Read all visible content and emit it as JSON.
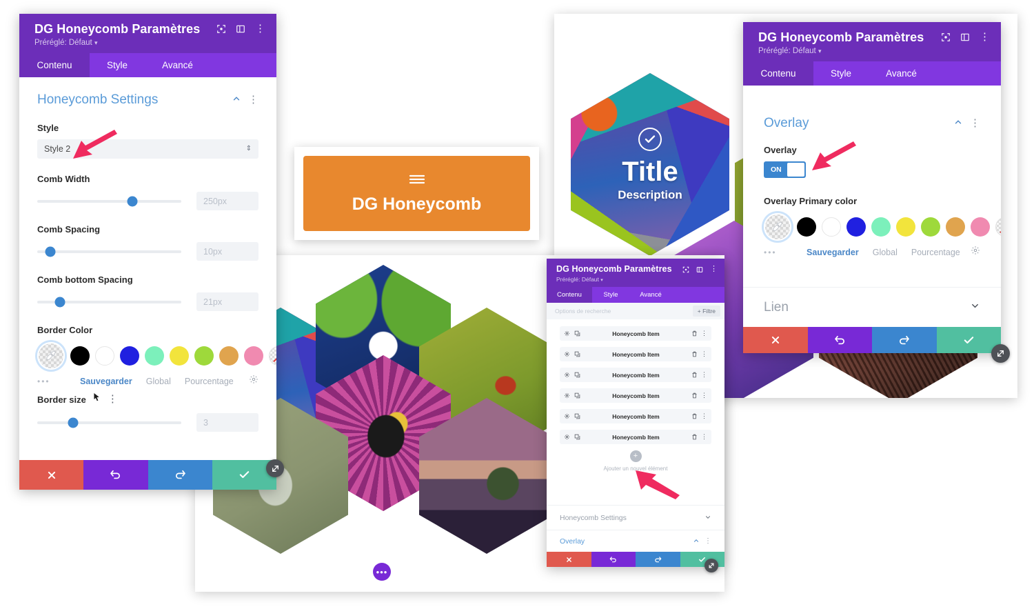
{
  "colors": {
    "header_purple": "#6c2eb9",
    "tabbar_purple": "#8137e0",
    "accent_blue": "#5a9bd8",
    "slider_blue": "#3b86cf",
    "orange_button": "#e8882e",
    "cancel_red": "#e0594e",
    "undo_purple": "#7829d6",
    "redo_blue": "#3b86cf",
    "save_green": "#51bfa0",
    "arrow_pink": "#ef2b5f"
  },
  "palette": {
    "swatches": [
      "#000000",
      "#ffffff",
      "#2020e0",
      "#7cf0bb",
      "#f2e43c",
      "#9ed93b",
      "#e0a44e",
      "#f08ab0"
    ],
    "picker_icon": "eyedropper-icon",
    "none_label": "no-color",
    "links": [
      {
        "label": "Sauvegarder",
        "active": true
      },
      {
        "label": "Global",
        "active": false
      },
      {
        "label": "Pourcentage",
        "active": false
      }
    ],
    "gear_icon": "gear-icon",
    "more_dots": "•••"
  },
  "left_panel": {
    "header": {
      "title": "DG Honeycomb Paramètres",
      "preset": "Préréglé: Défaut",
      "icons": [
        "fullscreen-icon",
        "layout-icon",
        "kebab-menu-icon"
      ]
    },
    "tabs": [
      {
        "label": "Contenu",
        "active": true
      },
      {
        "label": "Style",
        "active": false
      },
      {
        "label": "Avancé",
        "active": false
      }
    ],
    "section": {
      "title": "Honeycomb Settings",
      "collapse_icon": "chevron-up-icon",
      "kebab_icon": "kebab-menu-icon"
    },
    "fields": {
      "style_label": "Style",
      "style_value": "Style 2",
      "comb_width_label": "Comb Width",
      "comb_width_value": "250px",
      "comb_width_pct": 66,
      "comb_spacing_label": "Comb Spacing",
      "comb_spacing_value": "10px",
      "comb_spacing_pct": 9,
      "comb_bottom_label": "Comb bottom Spacing",
      "comb_bottom_value": "21px",
      "comb_bottom_pct": 16,
      "border_color_label": "Border Color",
      "border_size_label": "Border size",
      "border_size_value": "3",
      "border_size_pct": 25
    },
    "actions": [
      {
        "name": "cancel",
        "icon": "close-icon"
      },
      {
        "name": "undo",
        "icon": "undo-icon"
      },
      {
        "name": "redo",
        "icon": "redo-icon"
      },
      {
        "name": "save",
        "icon": "check-icon"
      }
    ]
  },
  "center_module": {
    "icon": "hamburger-icon",
    "label": "DG Honeycomb"
  },
  "hero_hex": {
    "check_icon": "check-circle-icon",
    "title": "Title",
    "description": "Description"
  },
  "middle_panel": {
    "header": {
      "title": "DG Honeycomb Paramètres",
      "preset": "Préréglé: Défaut",
      "icons": [
        "fullscreen-icon",
        "layout-icon",
        "kebab-menu-icon"
      ]
    },
    "tabs": [
      {
        "label": "Contenu",
        "active": true
      },
      {
        "label": "Style",
        "active": false
      },
      {
        "label": "Avancé",
        "active": false
      }
    ],
    "search_placeholder": "Options de recherche",
    "filter_button": "Filtre",
    "filter_icon": "plus-icon",
    "items": [
      {
        "name": "Honeycomb Item"
      },
      {
        "name": "Honeycomb Item"
      },
      {
        "name": "Honeycomb Item"
      },
      {
        "name": "Honeycomb Item"
      },
      {
        "name": "Honeycomb Item"
      },
      {
        "name": "Honeycomb Item"
      }
    ],
    "item_icons": {
      "settings": "gear-icon",
      "duplicate": "duplicate-icon",
      "delete": "trash-icon",
      "more": "kebab-menu-icon"
    },
    "add_button_icon": "plus-icon",
    "add_label": "Ajouter un nouvel élément",
    "collapsed_sections": [
      {
        "title": "Honeycomb Settings",
        "icon": "chevron-down-icon",
        "blue": false
      },
      {
        "title": "Overlay",
        "icon": "chevron-up-icon",
        "blue": true
      }
    ],
    "actions": [
      {
        "name": "cancel",
        "icon": "close-icon"
      },
      {
        "name": "undo",
        "icon": "undo-icon"
      },
      {
        "name": "redo",
        "icon": "redo-icon"
      },
      {
        "name": "save",
        "icon": "check-icon"
      }
    ]
  },
  "right_panel": {
    "header": {
      "title": "DG Honeycomb Paramètres",
      "preset": "Préréglé: Défaut",
      "icons": [
        "fullscreen-icon",
        "layout-icon",
        "kebab-menu-icon"
      ]
    },
    "tabs": [
      {
        "label": "Contenu",
        "active": true
      },
      {
        "label": "Style",
        "active": false
      },
      {
        "label": "Avancé",
        "active": false
      }
    ],
    "section": {
      "title": "Overlay",
      "collapse_icon": "chevron-up-icon",
      "kebab_icon": "kebab-menu-icon"
    },
    "overlay_label": "Overlay",
    "toggle_state": "ON",
    "overlay_color_label": "Overlay Primary color",
    "link_section": "Lien",
    "link_icon": "chevron-down-icon",
    "actions": [
      {
        "name": "cancel",
        "icon": "close-icon"
      },
      {
        "name": "undo",
        "icon": "undo-icon"
      },
      {
        "name": "redo",
        "icon": "redo-icon"
      },
      {
        "name": "save",
        "icon": "check-icon"
      }
    ]
  },
  "canvas": {
    "more_options_icon": "ellipsis-icon"
  }
}
